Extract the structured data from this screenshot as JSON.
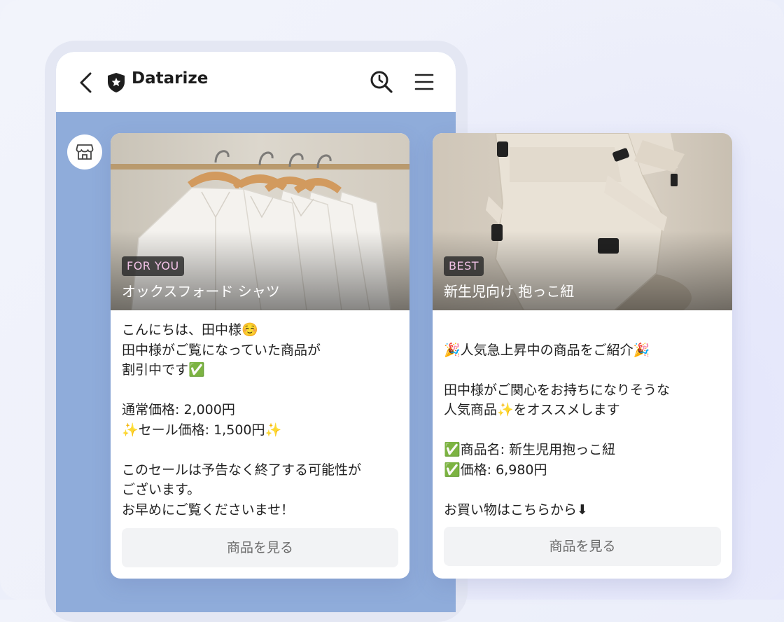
{
  "app": {
    "title": "Datarize"
  },
  "icons": {
    "back": "chevron-left-icon",
    "brand": "shield-star-icon",
    "search": "search-icon",
    "menu": "hamburger-menu-icon",
    "shop": "store-icon"
  },
  "colors": {
    "chat_background": "#8facda",
    "badge_text": "#f1c2e6",
    "button_background": "#f2f3f5"
  },
  "cards": [
    {
      "badge": "FOR YOU",
      "product_title": "オックスフォード シャツ",
      "lines": [
        "こんにちは、田中様☺️",
        "田中様がご覧になっていた商品が",
        "割引中です✅",
        "",
        "通常価格: 2,000円",
        "✨セール価格: 1,500円✨",
        "",
        "このセールは予告なく終了する可能性が",
        "ございます。",
        "お早めにご覧くださいませ！"
      ],
      "button": "商品を見る"
    },
    {
      "badge": "BEST",
      "product_title": "新生児向け 抱っこ紐",
      "lines": [
        "",
        "🎉人気急上昇中の商品をご紹介🎉",
        "",
        "田中様がご関心をお持ちになりそうな",
        "人気商品✨をオススメします",
        "",
        "✅商品名: 新生児用抱っこ紐",
        "✅価格: 6,980円",
        "",
        "お買い物はこちらから⬇"
      ],
      "button": "商品を見る"
    }
  ]
}
